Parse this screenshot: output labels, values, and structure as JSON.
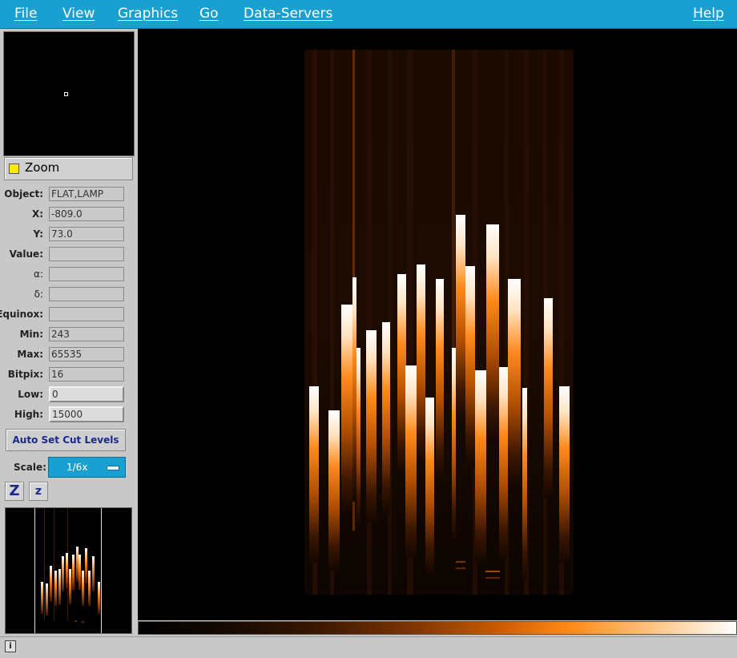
{
  "menubar": {
    "file": "File",
    "view": "View",
    "graphics": "Graphics",
    "go": "Go",
    "data_servers": "Data-Servers",
    "help": "Help"
  },
  "zoom": {
    "label": "Zoom"
  },
  "info": {
    "object": {
      "label": "Object:",
      "value": "FLAT,LAMP"
    },
    "x": {
      "label": "X:",
      "value": "-809.0"
    },
    "y": {
      "label": "Y:",
      "value": "73.0"
    },
    "value": {
      "label": "Value:",
      "value": ""
    },
    "alpha": {
      "label": "α:",
      "value": ""
    },
    "delta": {
      "label": "δ:",
      "value": ""
    },
    "equinox": {
      "label": "Equinox:",
      "value": ""
    },
    "min": {
      "label": "Min:",
      "value": "243"
    },
    "max": {
      "label": "Max:",
      "value": "65535"
    },
    "bitpix": {
      "label": "Bitpix:",
      "value": "16"
    },
    "low": {
      "label": "Low:",
      "value": "0"
    },
    "high": {
      "label": "High:",
      "value": "15000"
    }
  },
  "auto_set_cut_levels": "Auto Set Cut Levels",
  "scale": {
    "label": "Scale:",
    "value": "1/6x"
  },
  "zoom_buttons": {
    "zoom_in": "Z",
    "zoom_out": "z"
  },
  "status": {
    "info_icon": "info-icon",
    "text": ""
  },
  "colors": {
    "menubar": "#1aa0d0",
    "accent_orange": "#ff7a10",
    "zoom_check": "#ffea00"
  }
}
